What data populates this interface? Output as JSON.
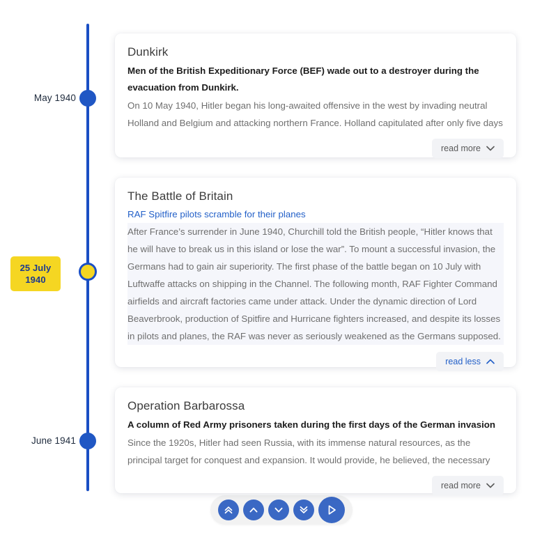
{
  "timeline": {
    "markers": [
      {
        "label": "May 1940",
        "active": false
      },
      {
        "label": "25 July\n1940",
        "label_line1": "25 July",
        "label_line2": "1940",
        "active": true
      },
      {
        "label": "June 1941",
        "active": false
      }
    ],
    "accent_color": "#1a4fc4",
    "active_color": "#f5d622"
  },
  "cards": [
    {
      "title": "Dunkirk",
      "caption": "Men of the British Expeditionary Force (BEF) wade out to a destroyer during the evacuation from Dunkirk.",
      "body": "On 10 May 1940, Hitler began his long-awaited offensive in the west by invading neutral Holland and Belgium and attacking northern France. Holland capitulated after only five days of fighting,",
      "toggle_label": "read more",
      "toggle_state": "collapsed"
    },
    {
      "title": "The Battle of Britain",
      "caption": "RAF Spitfire pilots scramble for their planes",
      "body": "After France’s surrender in June 1940, Churchill told the British people, “Hitler knows that he will have to break us in this island or lose the war”. To mount a successful invasion, the Germans had to gain air superiority. The first phase of the battle began on 10 July with Luftwaffe attacks on shipping in the Channel. The following month, RAF Fighter Command airfields and aircraft factories came under attack. Under the dynamic direction of Lord Beaverbrook, production of Spitfire and Hurricane fighters increased, and despite its losses in pilots and planes, the RAF was never as seriously weakened as the Germans supposed.",
      "toggle_label": "read less",
      "toggle_state": "expanded"
    },
    {
      "title": "Operation Barbarossa",
      "caption": "A column of Red Army prisoners taken during the first days of the German invasion",
      "body": "Since the 1920s, Hitler had seen Russia, with its immense natural resources, as the principal target for conquest and expansion. It would provide, he believed, the necessary ‘Lebensraum’, or living",
      "toggle_label": "read more",
      "toggle_state": "collapsed"
    }
  ],
  "nav": {
    "buttons": [
      {
        "name": "first",
        "icon": "double-chevron-up-icon"
      },
      {
        "name": "previous",
        "icon": "chevron-up-icon"
      },
      {
        "name": "next",
        "icon": "chevron-down-icon"
      },
      {
        "name": "last",
        "icon": "double-chevron-down-icon"
      },
      {
        "name": "play",
        "icon": "play-icon"
      }
    ]
  }
}
